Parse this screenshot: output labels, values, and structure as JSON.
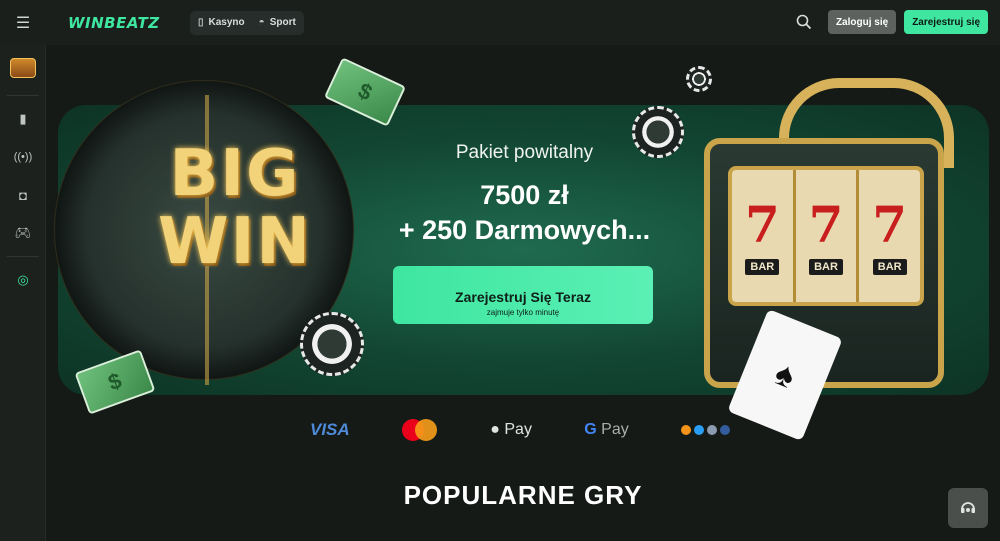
{
  "header": {
    "logo": "WINBEATZ",
    "nav": [
      {
        "label": "Kasyno",
        "icon": "casino-icon"
      },
      {
        "label": "Sport",
        "icon": "sport-icon"
      }
    ],
    "login_label": "Zaloguj się",
    "register_label": "Zarejestruj się"
  },
  "sidebar": {
    "items": [
      {
        "icon": "treasure-chest-icon"
      },
      {
        "icon": "slot-machine-icon"
      },
      {
        "icon": "live-broadcast-icon"
      },
      {
        "icon": "vr-headset-icon"
      },
      {
        "icon": "gamepad-icon"
      },
      {
        "icon": "support-headset-icon"
      }
    ]
  },
  "banner": {
    "art_text": "BIG WIN",
    "subtitle": "Pakiet powitalny",
    "amount": "7500 zł",
    "bonus": "+ 250 Darmowych...",
    "cta_title": "Zarejestruj Się Teraz",
    "cta_sub": "zajmuje tylko minutę",
    "reels": [
      "7",
      "7",
      "7"
    ],
    "reel_labels": [
      "BAR",
      "BAR",
      "BAR"
    ]
  },
  "payments": {
    "visa": "VISA",
    "apple_pay": "Pay",
    "google_pay": "Pay"
  },
  "section_title": "POPULARNE GRY",
  "colors": {
    "accent": "#3ee6a0",
    "background": "#151a17",
    "banner_green": "#1f6b50"
  }
}
